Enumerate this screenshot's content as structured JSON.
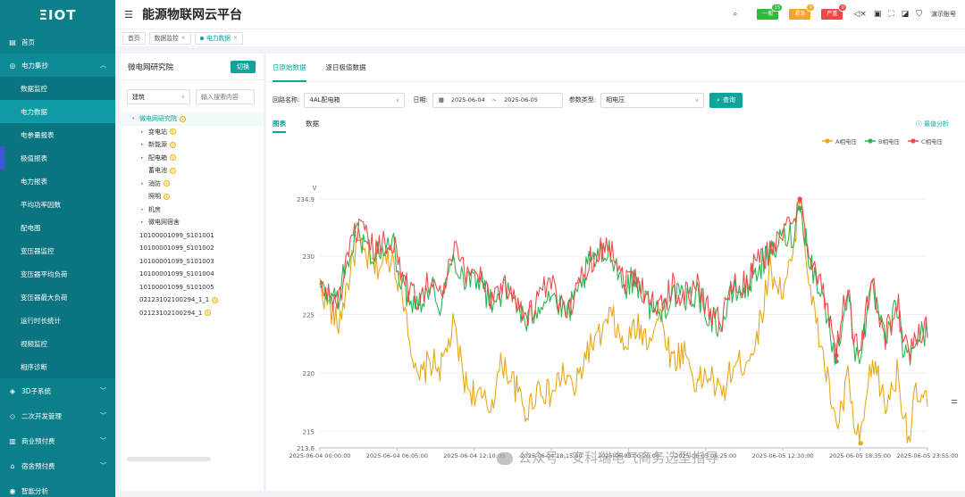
{
  "sidebar": {
    "logo": "ΞIOT",
    "items_top": [
      {
        "label": "首页",
        "icon": "monitor-icon"
      }
    ],
    "group": {
      "label": "电力集抄",
      "icon": "gauge-icon"
    },
    "sub_items": [
      {
        "label": "数据监控"
      },
      {
        "label": "电力数据"
      },
      {
        "label": "电参量报表"
      },
      {
        "label": "极值报表"
      },
      {
        "label": "电力报表"
      },
      {
        "label": "平均功率因数"
      },
      {
        "label": "配电图"
      },
      {
        "label": "变压器监控"
      },
      {
        "label": "变压器平均负荷"
      },
      {
        "label": "变压器最大负荷"
      },
      {
        "label": "运行时长统计"
      },
      {
        "label": "视频监控"
      },
      {
        "label": "相序诊断"
      }
    ],
    "items_bottom": [
      {
        "label": "3D子系统",
        "icon": "cube-icon"
      },
      {
        "label": "二次开发管理",
        "icon": "layers-icon"
      },
      {
        "label": "商业预付费",
        "icon": "building-icon"
      },
      {
        "label": "宿舍预付费",
        "icon": "house-icon"
      },
      {
        "label": "智能分析",
        "icon": "analysis-icon"
      }
    ]
  },
  "header": {
    "title": "能源物联网云平台",
    "alarms": [
      {
        "label": "一般",
        "count": "15",
        "color": "#2dbb3c"
      },
      {
        "label": "紧急",
        "count": "0",
        "color": "#f5a623"
      },
      {
        "label": "严重",
        "count": "0",
        "color": "#f04848"
      }
    ],
    "account": "演示账号"
  },
  "tabs": [
    {
      "label": "首页"
    },
    {
      "label": "数据监控"
    },
    {
      "label": "电力数据"
    }
  ],
  "tree_panel": {
    "title": "微电网研究院",
    "switch_label": "切换",
    "select_value": "建筑",
    "search_placeholder": "输入搜索内容",
    "nodes": [
      {
        "label": "微电网研究院",
        "level": 0,
        "arrow": "▾",
        "badge": true
      },
      {
        "label": "变电站",
        "level": 1,
        "arrow": "▸",
        "badge": true
      },
      {
        "label": "新能源",
        "level": 1,
        "arrow": "▸",
        "badge": true
      },
      {
        "label": "配电箱",
        "level": 1,
        "arrow": "▸",
        "badge": true
      },
      {
        "label": "蓄电池",
        "level": 1,
        "arrow": "",
        "badge": true
      },
      {
        "label": "消防",
        "level": 1,
        "arrow": "▸",
        "badge": true
      },
      {
        "label": "照明",
        "level": 1,
        "arrow": "",
        "badge": true
      },
      {
        "label": "机房",
        "level": 1,
        "arrow": "▸",
        "badge": false
      },
      {
        "label": "微电网宿舍",
        "level": 1,
        "arrow": "▸",
        "badge": false
      },
      {
        "label": "10100001099_S101001",
        "level": 2,
        "arrow": "",
        "badge": false
      },
      {
        "label": "10100001099_S101002",
        "level": 2,
        "arrow": "",
        "badge": false
      },
      {
        "label": "10100001099_S101003",
        "level": 2,
        "arrow": "",
        "badge": false
      },
      {
        "label": "10100001099_S101004",
        "level": 2,
        "arrow": "",
        "badge": false
      },
      {
        "label": "10100001099_S101005",
        "level": 2,
        "arrow": "",
        "badge": false
      },
      {
        "label": "02123102100294_1_1",
        "level": 2,
        "arrow": "",
        "badge": true
      },
      {
        "label": "02123102100294_1",
        "level": 2,
        "arrow": "",
        "badge": true
      }
    ]
  },
  "main": {
    "tabs": [
      {
        "label": "日原始数据"
      },
      {
        "label": "逐日极值数据"
      }
    ],
    "query": {
      "loop_label": "回路名称:",
      "loop_value": "4AL配电箱",
      "date_label": "日期:",
      "date_start": "2025-06-04",
      "date_sep": "~",
      "date_end": "2025-06-05",
      "param_label": "参数类型:",
      "param_value": "相电压",
      "search_btn": "查询"
    },
    "view_tabs": [
      {
        "label": "图表"
      },
      {
        "label": "数据"
      }
    ],
    "peak_label": "ⓘ 最值分析"
  },
  "chart_data": {
    "type": "line",
    "ylabel": "V",
    "ylim": [
      213.6,
      234.9
    ],
    "yticks": [
      213.6,
      215,
      220,
      225,
      230,
      234.9
    ],
    "x_ticks": [
      "2025-06-04 00:00:00",
      "2025-06-04 06:05:00",
      "2025-06-04 12:10:00",
      "2025-06-04 18:15:00",
      "2025-06-05 00:20:00",
      "2025-06-05 06:25:00",
      "2025-06-05 12:30:00",
      "2025-06-05 18:35:00",
      "2025-06-05 23:55:00"
    ],
    "x_tick_fractions": [
      0,
      0.127,
      0.254,
      0.381,
      0.508,
      0.635,
      0.762,
      0.889,
      1.0
    ],
    "legend_position": "top-right",
    "series": [
      {
        "name": "A相电压",
        "color": "#e6a817",
        "anchors": [
          [
            0,
            227.5
          ],
          [
            0.03,
            224
          ],
          [
            0.06,
            231
          ],
          [
            0.09,
            229
          ],
          [
            0.12,
            230
          ],
          [
            0.14,
            226
          ],
          [
            0.16,
            219
          ],
          [
            0.18,
            221
          ],
          [
            0.2,
            220.5
          ],
          [
            0.22,
            224
          ],
          [
            0.24,
            219
          ],
          [
            0.26,
            218
          ],
          [
            0.28,
            217
          ],
          [
            0.3,
            221
          ],
          [
            0.32,
            219
          ],
          [
            0.34,
            216.5
          ],
          [
            0.36,
            219
          ],
          [
            0.38,
            218
          ],
          [
            0.4,
            220
          ],
          [
            0.42,
            218.5
          ],
          [
            0.44,
            222
          ],
          [
            0.46,
            223
          ],
          [
            0.48,
            225
          ],
          [
            0.5,
            222
          ],
          [
            0.52,
            224
          ],
          [
            0.54,
            223
          ],
          [
            0.56,
            225
          ],
          [
            0.58,
            221
          ],
          [
            0.6,
            222
          ],
          [
            0.62,
            219
          ],
          [
            0.64,
            220
          ],
          [
            0.66,
            218
          ],
          [
            0.68,
            220.5
          ],
          [
            0.7,
            221
          ],
          [
            0.72,
            223
          ],
          [
            0.74,
            229
          ],
          [
            0.76,
            227
          ],
          [
            0.78,
            230
          ],
          [
            0.79,
            234.7
          ],
          [
            0.81,
            226
          ],
          [
            0.83,
            221
          ],
          [
            0.85,
            215.5
          ],
          [
            0.86,
            217
          ],
          [
            0.87,
            220
          ],
          [
            0.88,
            215
          ],
          [
            0.89,
            214
          ],
          [
            0.9,
            218
          ],
          [
            0.91,
            221
          ],
          [
            0.92,
            219.5
          ],
          [
            0.93,
            217
          ],
          [
            0.94,
            218.5
          ],
          [
            0.95,
            220
          ],
          [
            0.96,
            217
          ],
          [
            0.97,
            214.5
          ],
          [
            0.98,
            218
          ],
          [
            1.0,
            217.5
          ]
        ]
      },
      {
        "name": "B相电压",
        "color": "#2ab650",
        "anchors": [
          [
            0,
            227
          ],
          [
            0.03,
            226.5
          ],
          [
            0.06,
            232
          ],
          [
            0.09,
            230
          ],
          [
            0.12,
            231
          ],
          [
            0.14,
            227
          ],
          [
            0.16,
            226
          ],
          [
            0.18,
            227.5
          ],
          [
            0.2,
            226
          ],
          [
            0.22,
            230
          ],
          [
            0.24,
            228
          ],
          [
            0.26,
            228.5
          ],
          [
            0.28,
            226
          ],
          [
            0.3,
            227
          ],
          [
            0.32,
            226.5
          ],
          [
            0.34,
            224
          ],
          [
            0.36,
            226
          ],
          [
            0.38,
            227
          ],
          [
            0.4,
            225
          ],
          [
            0.42,
            226
          ],
          [
            0.44,
            229
          ],
          [
            0.46,
            230
          ],
          [
            0.48,
            230.5
          ],
          [
            0.5,
            227.5
          ],
          [
            0.52,
            228
          ],
          [
            0.54,
            226
          ],
          [
            0.56,
            225
          ],
          [
            0.58,
            227
          ],
          [
            0.6,
            226
          ],
          [
            0.62,
            227
          ],
          [
            0.64,
            225
          ],
          [
            0.66,
            224
          ],
          [
            0.68,
            227
          ],
          [
            0.7,
            227
          ],
          [
            0.72,
            229
          ],
          [
            0.74,
            230
          ],
          [
            0.76,
            231.5
          ],
          [
            0.78,
            232
          ],
          [
            0.79,
            234.1
          ],
          [
            0.81,
            229
          ],
          [
            0.83,
            226
          ],
          [
            0.85,
            221
          ],
          [
            0.86,
            225
          ],
          [
            0.87,
            227
          ],
          [
            0.88,
            221.5
          ],
          [
            0.89,
            222
          ],
          [
            0.9,
            225
          ],
          [
            0.91,
            227
          ],
          [
            0.92,
            225
          ],
          [
            0.93,
            222.5
          ],
          [
            0.94,
            224
          ],
          [
            0.95,
            226
          ],
          [
            0.96,
            222
          ],
          [
            0.97,
            221
          ],
          [
            0.98,
            223
          ],
          [
            1.0,
            223.5
          ]
        ]
      },
      {
        "name": "C相电压",
        "color": "#ef4a4a",
        "anchors": [
          [
            0,
            227.3
          ],
          [
            0.03,
            226
          ],
          [
            0.06,
            232.5
          ],
          [
            0.09,
            230.5
          ],
          [
            0.12,
            231.5
          ],
          [
            0.14,
            227.5
          ],
          [
            0.16,
            226.5
          ],
          [
            0.18,
            228
          ],
          [
            0.2,
            226.5
          ],
          [
            0.22,
            230.5
          ],
          [
            0.24,
            228.5
          ],
          [
            0.26,
            229
          ],
          [
            0.28,
            226.5
          ],
          [
            0.3,
            227.5
          ],
          [
            0.32,
            227
          ],
          [
            0.34,
            224.5
          ],
          [
            0.36,
            226.5
          ],
          [
            0.38,
            227.5
          ],
          [
            0.4,
            225.5
          ],
          [
            0.42,
            226.5
          ],
          [
            0.44,
            229.5
          ],
          [
            0.46,
            230.5
          ],
          [
            0.48,
            231
          ],
          [
            0.5,
            228
          ],
          [
            0.52,
            228.5
          ],
          [
            0.54,
            226.5
          ],
          [
            0.56,
            225.5
          ],
          [
            0.58,
            227.5
          ],
          [
            0.6,
            226.5
          ],
          [
            0.62,
            227.5
          ],
          [
            0.64,
            225.5
          ],
          [
            0.66,
            224.5
          ],
          [
            0.68,
            227.5
          ],
          [
            0.7,
            227.5
          ],
          [
            0.72,
            229.5
          ],
          [
            0.74,
            230.5
          ],
          [
            0.76,
            232
          ],
          [
            0.78,
            232.5
          ],
          [
            0.79,
            234.9
          ],
          [
            0.81,
            229.5
          ],
          [
            0.83,
            226.5
          ],
          [
            0.85,
            221.5
          ],
          [
            0.86,
            225.5
          ],
          [
            0.87,
            227.5
          ],
          [
            0.88,
            222
          ],
          [
            0.89,
            222.5
          ],
          [
            0.9,
            225.5
          ],
          [
            0.91,
            227.5
          ],
          [
            0.92,
            225.5
          ],
          [
            0.93,
            223
          ],
          [
            0.94,
            224.5
          ],
          [
            0.95,
            226.5
          ],
          [
            0.96,
            222.5
          ],
          [
            0.97,
            221.5
          ],
          [
            0.98,
            223.5
          ],
          [
            1.0,
            224
          ]
        ]
      }
    ]
  },
  "watermark": "公众号 · 安科瑞电气商务选型指导"
}
